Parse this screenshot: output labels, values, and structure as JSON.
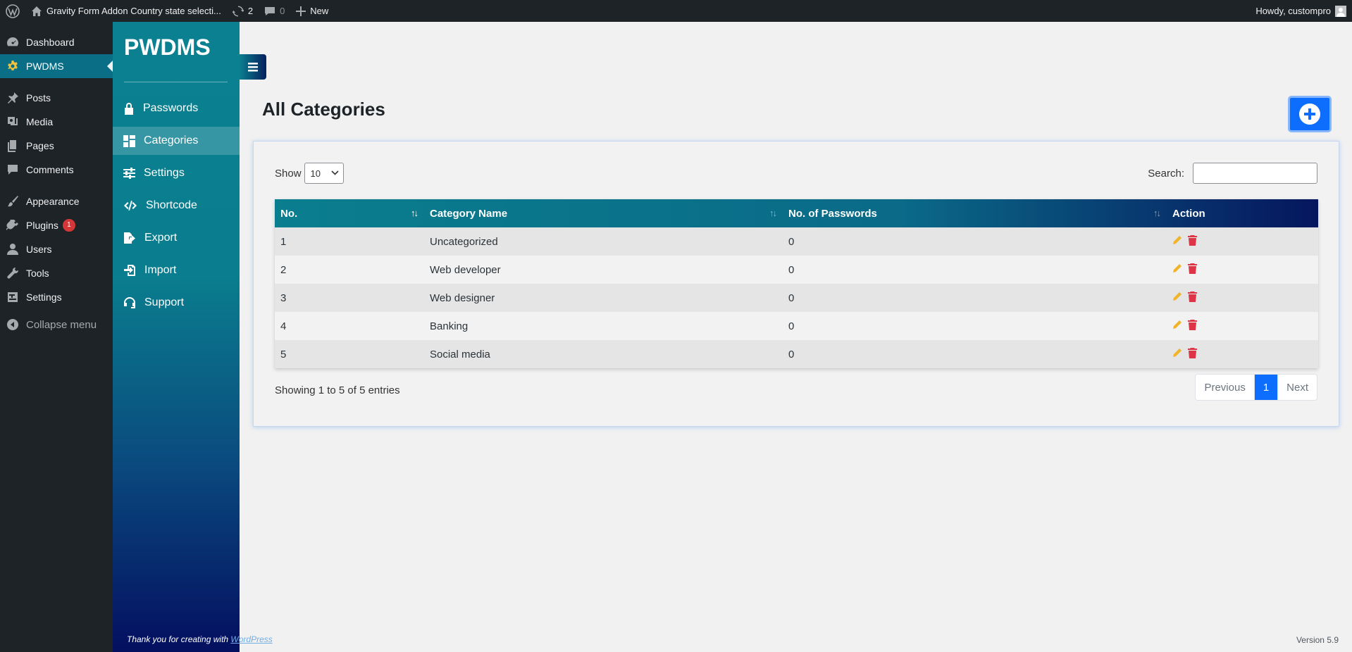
{
  "adminbar": {
    "site_title": "Gravity Form Addon Country state selecti...",
    "updates_count": "2",
    "comments_count": "0",
    "new_label": "New",
    "howdy": "Howdy, custompro"
  },
  "wpmenu": {
    "items": [
      {
        "label": "Dashboard"
      },
      {
        "label": "PWDMS"
      },
      {
        "label": "Posts"
      },
      {
        "label": "Media"
      },
      {
        "label": "Pages"
      },
      {
        "label": "Comments"
      },
      {
        "label": "Appearance"
      },
      {
        "label": "Plugins",
        "badge": "1"
      },
      {
        "label": "Users"
      },
      {
        "label": "Tools"
      },
      {
        "label": "Settings"
      },
      {
        "label": "Collapse menu"
      }
    ]
  },
  "plugin": {
    "brand": "PWDMS",
    "nav": [
      {
        "label": "Passwords"
      },
      {
        "label": "Categories"
      },
      {
        "label": "Settings"
      },
      {
        "label": "Shortcode"
      },
      {
        "label": "Export"
      },
      {
        "label": "Import"
      },
      {
        "label": "Support"
      }
    ],
    "footer_text": "Thank you for creating with",
    "footer_link": "WordPress"
  },
  "page": {
    "title": "All Categories"
  },
  "table_controls": {
    "show_label": "Show",
    "show_value": "10",
    "search_label": "Search:",
    "search_value": ""
  },
  "table": {
    "columns": [
      "No.",
      "Category Name",
      "No. of Passwords",
      "Action"
    ],
    "rows": [
      {
        "no": "1",
        "name": "Uncategorized",
        "count": "0"
      },
      {
        "no": "2",
        "name": "Web developer",
        "count": "0"
      },
      {
        "no": "3",
        "name": "Web designer",
        "count": "0"
      },
      {
        "no": "4",
        "name": "Banking",
        "count": "0"
      },
      {
        "no": "5",
        "name": "Social media",
        "count": "0"
      }
    ]
  },
  "footer": {
    "info": "Showing 1 to 5 of 5 entries",
    "previous": "Previous",
    "page": "1",
    "next": "Next",
    "version": "Version 5.9"
  },
  "colors": {
    "primary": "#0d6efd",
    "edit": "#f0b429",
    "delete": "#dc3545",
    "active_menu": "#0a6e87"
  }
}
